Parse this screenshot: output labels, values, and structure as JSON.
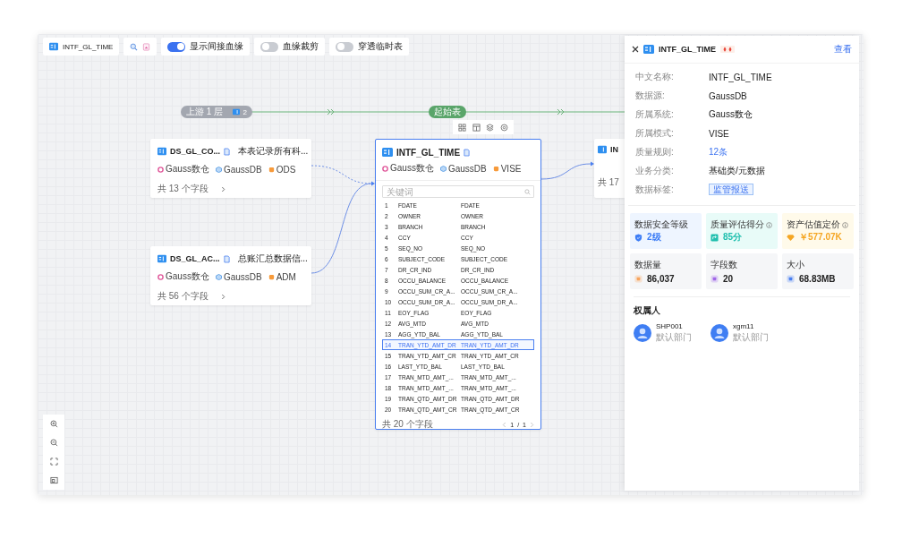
{
  "toolbar": {
    "table_name": "INTF_GL_TIME",
    "toggles": [
      {
        "label": "显示间接血缘",
        "on": true
      },
      {
        "label": "血缘裁剪",
        "on": false
      },
      {
        "label": "穿透临时表",
        "on": false
      }
    ]
  },
  "lineage": {
    "upstream_label": "上游 1 层",
    "upstream_count": "2",
    "start_label": "起始表"
  },
  "sources": [
    {
      "title": "DS_GL_CO...",
      "description": "本表记录所有科...",
      "system": "Gauss数仓",
      "datasource": "GaussDB",
      "schema": "ODS",
      "field_count": "共 13 个字段"
    },
    {
      "title": "DS_GL_AC...",
      "description": "总账汇总数据信...",
      "system": "Gauss数仓",
      "datasource": "GaussDB",
      "schema": "ADM",
      "field_count": "共 56 个字段"
    }
  ],
  "downstream": {
    "title": "IN",
    "field_count": "共 17"
  },
  "center": {
    "title": "INTF_GL_TIME",
    "system": "Gauss数仓",
    "datasource": "GaussDB",
    "schema": "VISE",
    "search_placeholder": "关键词",
    "fields": [
      {
        "index": "1",
        "name": "FDATE",
        "cn_name": "FDATE",
        "selected": false
      },
      {
        "index": "2",
        "name": "OWNER",
        "cn_name": "OWNER",
        "selected": false
      },
      {
        "index": "3",
        "name": "BRANCH",
        "cn_name": "BRANCH",
        "selected": false
      },
      {
        "index": "4",
        "name": "CCY",
        "cn_name": "CCY",
        "selected": false
      },
      {
        "index": "5",
        "name": "SEQ_NO",
        "cn_name": "SEQ_NO",
        "selected": false
      },
      {
        "index": "6",
        "name": "SUBJECT_CODE",
        "cn_name": "SUBJECT_CODE",
        "selected": false
      },
      {
        "index": "7",
        "name": "DR_CR_IND",
        "cn_name": "DR_CR_IND",
        "selected": false
      },
      {
        "index": "8",
        "name": "OCCU_BALANCE",
        "cn_name": "OCCU_BALANCE",
        "selected": false
      },
      {
        "index": "9",
        "name": "OCCU_SUM_CR_A...",
        "cn_name": "OCCU_SUM_CR_A...",
        "selected": false
      },
      {
        "index": "10",
        "name": "OCCU_SUM_DR_A...",
        "cn_name": "OCCU_SUM_DR_A...",
        "selected": false
      },
      {
        "index": "11",
        "name": "EOY_FLAG",
        "cn_name": "EOY_FLAG",
        "selected": false
      },
      {
        "index": "12",
        "name": "AVG_MTD",
        "cn_name": "AVG_MTD",
        "selected": false
      },
      {
        "index": "13",
        "name": "AGG_YTD_BAL",
        "cn_name": "AGG_YTD_BAL",
        "selected": false
      },
      {
        "index": "14",
        "name": "TRAN_YTD_AMT_DR",
        "cn_name": "TRAN_YTD_AMT_DR",
        "selected": true
      },
      {
        "index": "15",
        "name": "TRAN_YTD_AMT_CR",
        "cn_name": "TRAN_YTD_AMT_CR",
        "selected": false
      },
      {
        "index": "16",
        "name": "LAST_YTD_BAL",
        "cn_name": "LAST_YTD_BAL",
        "selected": false
      },
      {
        "index": "17",
        "name": "TRAN_MTD_AMT_...",
        "cn_name": "TRAN_MTD_AMT_...",
        "selected": false
      },
      {
        "index": "18",
        "name": "TRAN_MTD_AMT_...",
        "cn_name": "TRAN_MTD_AMT_...",
        "selected": false
      },
      {
        "index": "19",
        "name": "TRAN_QTD_AMT_DR",
        "cn_name": "TRAN_QTD_AMT_DR",
        "selected": false
      },
      {
        "index": "20",
        "name": "TRAN_QTD_AMT_CR",
        "cn_name": "TRAN_QTD_AMT_CR",
        "selected": false
      }
    ],
    "total": "共 20 个字段",
    "pager": {
      "current": "1",
      "separator": "/",
      "pages": "1"
    }
  },
  "panel": {
    "title": "INTF_GL_TIME",
    "link": "查看",
    "props": [
      {
        "label": "中文名称:",
        "value": "INTF_GL_TIME",
        "kind": "text"
      },
      {
        "label": "数据源:",
        "value": "GaussDB",
        "kind": "text"
      },
      {
        "label": "所属系统:",
        "value": "Gauss数仓",
        "kind": "text"
      },
      {
        "label": "所属模式:",
        "value": "VISE",
        "kind": "text"
      },
      {
        "label": "质量规则:",
        "value": "12条",
        "kind": "link"
      },
      {
        "label": "业务分类:",
        "value": "基础类/元数据",
        "kind": "text"
      },
      {
        "label": "数据标签:",
        "value": "监管报送",
        "kind": "tag"
      }
    ],
    "metrics": [
      {
        "label": "数据安全等级",
        "value": "2级",
        "kind": "security",
        "help": false
      },
      {
        "label": "质量评估得分",
        "value": "85分",
        "kind": "quality",
        "help": true
      },
      {
        "label": "资产估值定价",
        "value": "￥577.07K",
        "kind": "value",
        "help": true
      },
      {
        "label": "数据量",
        "value": "86,037",
        "kind": "count",
        "help": false
      },
      {
        "label": "字段数",
        "value": "20",
        "kind": "fields",
        "help": false
      },
      {
        "label": "大小",
        "value": "68.83MB",
        "kind": "size",
        "help": false
      }
    ],
    "owners_title": "权属人",
    "owners": [
      {
        "name": "SHP001",
        "dept": "默认部门"
      },
      {
        "name": "xgm11",
        "dept": "默认部门"
      }
    ]
  }
}
